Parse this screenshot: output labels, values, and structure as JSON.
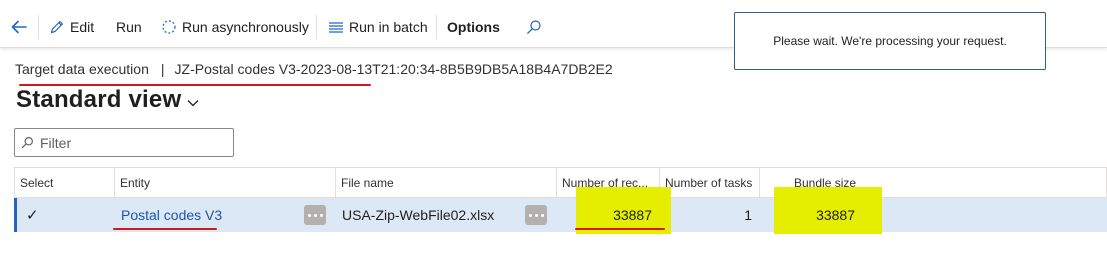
{
  "toolbar": {
    "edit_label": "Edit",
    "run_label": "Run",
    "run_async_label": "Run asynchronously",
    "run_batch_label": "Run in batch",
    "options_label": "Options",
    "icons": [
      "back-arrow-icon",
      "pencil-icon",
      "spinner-icon",
      "list-icon",
      "search-icon"
    ]
  },
  "toast": {
    "message": "Please wait. We're processing your request."
  },
  "breadcrumb": {
    "page": "Target data execution",
    "separator": "|",
    "record": "JZ-Postal codes V3-2023-08-13T21:20:34-8B5B9DB5A18B4A7DB2E2"
  },
  "view": {
    "title": "Standard view"
  },
  "filter": {
    "placeholder": "Filter"
  },
  "grid": {
    "columns": [
      "Select",
      "Entity",
      "File name",
      "Number of rec...",
      "Number of tasks",
      "Bundle size"
    ],
    "rows": [
      {
        "selected": "✓",
        "entity": "Postal codes V3",
        "file_name": "USA-Zip-WebFile02.xlsx",
        "num_records": "33887",
        "num_tasks": "1",
        "bundle_size": "33887"
      }
    ]
  },
  "colors": {
    "accent": "#2266c1",
    "selection_row": "#dde8f7",
    "highlight": "#e5ee00",
    "annotation": "#d11b1b"
  }
}
